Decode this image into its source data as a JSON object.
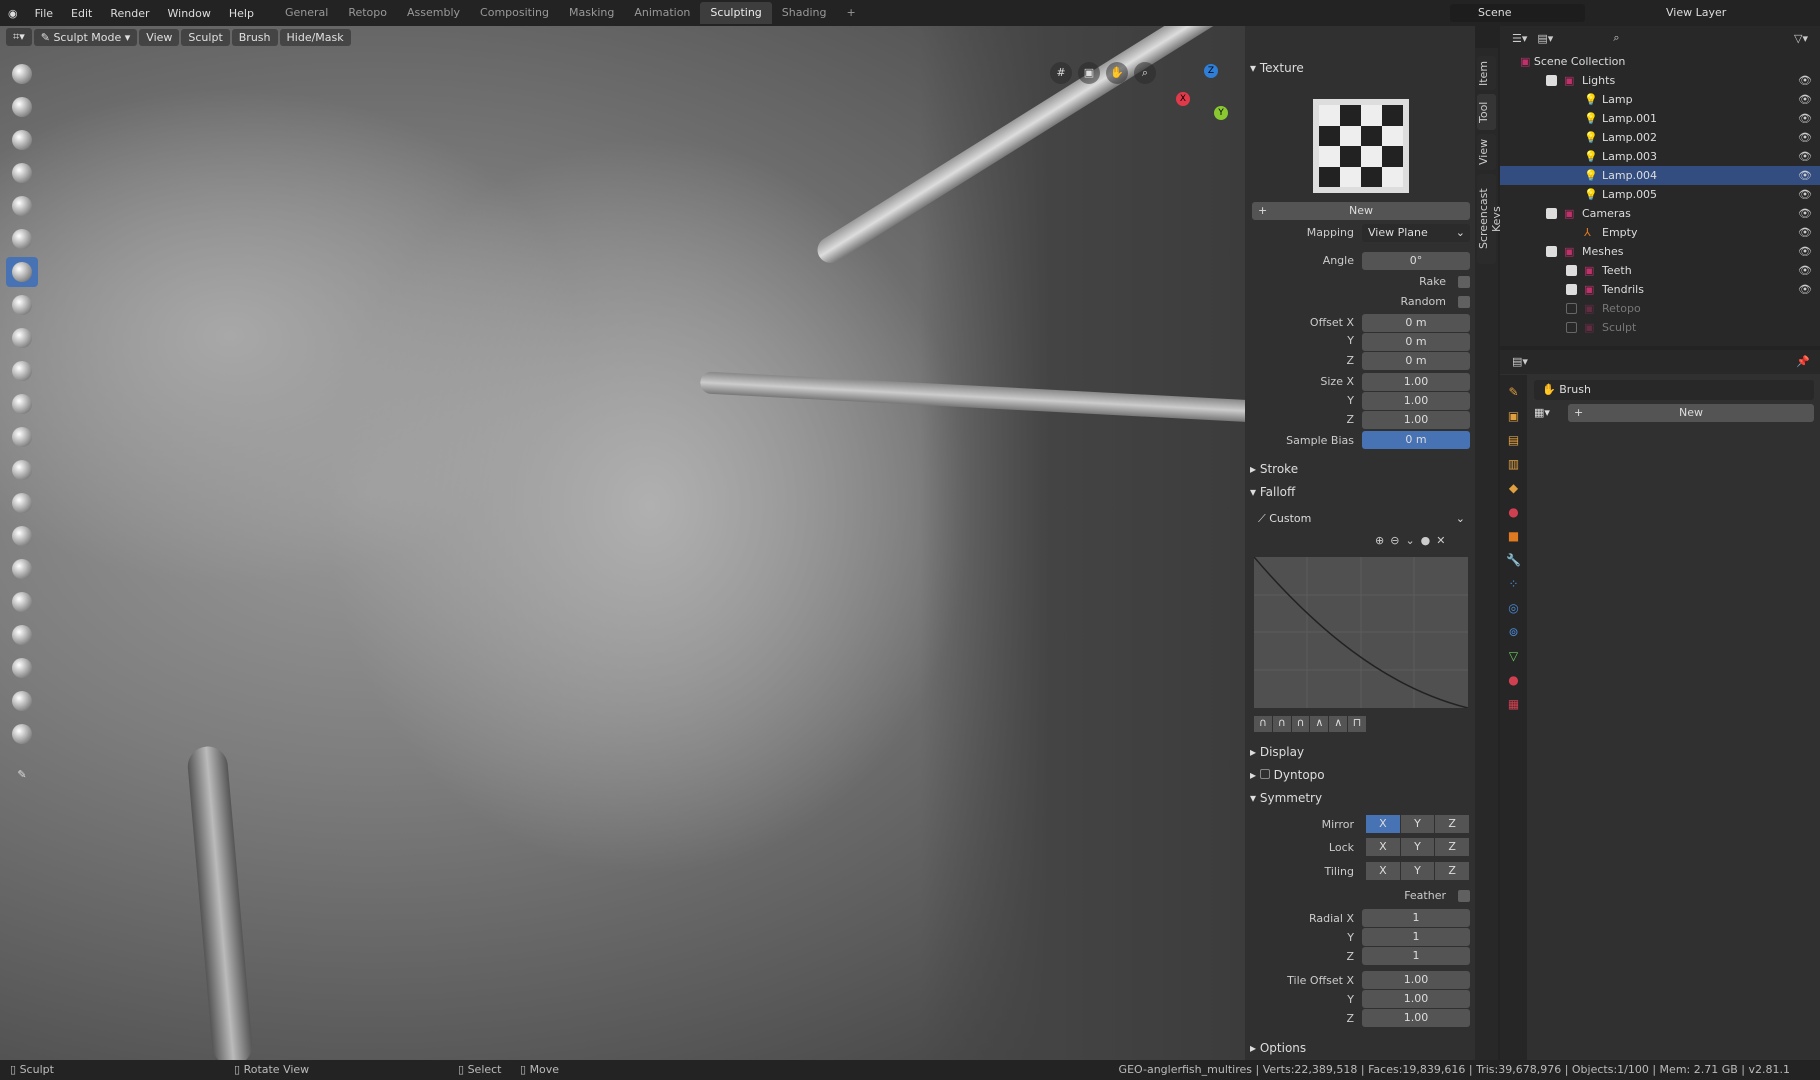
{
  "topbar": {
    "menus": [
      "File",
      "Edit",
      "Render",
      "Window",
      "Help"
    ],
    "workspaces": [
      "General",
      "Retopo",
      "Assembly",
      "Compositing",
      "Masking",
      "Animation",
      "Sculpting",
      "Shading"
    ],
    "active_workspace": "Sculpting",
    "scene": "Scene",
    "view_layer": "View Layer",
    "add_tab": "+"
  },
  "viewport_header": {
    "mode": "Sculpt Mode",
    "menus": [
      "View",
      "Sculpt",
      "Brush",
      "Hide/Mask"
    ]
  },
  "gizmo": {
    "x": "X",
    "y": "Y",
    "z": "Z"
  },
  "npanel": {
    "tabs": [
      "Item",
      "Tool",
      "View",
      "Screencast Keys"
    ],
    "active_tab": "Tool",
    "texture": {
      "title": "Texture",
      "new_label": "New",
      "mapping_label": "Mapping",
      "mapping": "View Plane",
      "angle_label": "Angle",
      "angle": "0°",
      "rake_label": "Rake",
      "random_label": "Random",
      "offset": {
        "label": "Offset X",
        "x": "0 m",
        "y": "0 m",
        "z": "0 m"
      },
      "size": {
        "label": "Size X",
        "x": "1.00",
        "y": "1.00",
        "z": "1.00"
      },
      "y_label": "Y",
      "z_label": "Z",
      "sample_bias_label": "Sample Bias",
      "sample_bias": "0 m"
    },
    "stroke": "Stroke",
    "falloff": {
      "title": "Falloff",
      "preset": "Custom"
    },
    "display": "Display",
    "dyntopo": "Dyntopo",
    "symmetry": {
      "title": "Symmetry",
      "mirror_label": "Mirror",
      "lock_label": "Lock",
      "tiling_label": "Tiling",
      "axes": [
        "X",
        "Y",
        "Z"
      ],
      "mirror_active": "X",
      "feather_label": "Feather",
      "radial": {
        "label": "Radial X",
        "x": "1",
        "y": "1",
        "z": "1"
      },
      "tile_offset": {
        "label": "Tile Offset X",
        "x": "1.00",
        "y": "1.00",
        "z": "1.00"
      }
    },
    "options": "Options"
  },
  "outliner": {
    "root": "Scene Collection",
    "items": [
      {
        "name": "Lights",
        "indent": 1,
        "type": "collection"
      },
      {
        "name": "Lamp",
        "indent": 2,
        "type": "light"
      },
      {
        "name": "Lamp.001",
        "indent": 2,
        "type": "light"
      },
      {
        "name": "Lamp.002",
        "indent": 2,
        "type": "light"
      },
      {
        "name": "Lamp.003",
        "indent": 2,
        "type": "light"
      },
      {
        "name": "Lamp.004",
        "indent": 2,
        "type": "light",
        "selected": true
      },
      {
        "name": "Lamp.005",
        "indent": 2,
        "type": "light"
      },
      {
        "name": "Cameras",
        "indent": 1,
        "type": "collection"
      },
      {
        "name": "Empty",
        "indent": 2,
        "type": "empty"
      },
      {
        "name": "Meshes",
        "indent": 1,
        "type": "collection"
      },
      {
        "name": "Teeth",
        "indent": 2,
        "type": "collection"
      },
      {
        "name": "Tendrils",
        "indent": 2,
        "type": "collection"
      },
      {
        "name": "Retopo",
        "indent": 2,
        "type": "collection",
        "disabled": true
      },
      {
        "name": "Sculpt",
        "indent": 2,
        "type": "collection",
        "disabled": true
      }
    ]
  },
  "properties": {
    "brush_label": "Brush",
    "new_label": "New"
  },
  "statusbar": {
    "sculpt": "Sculpt",
    "rotate": "Rotate View",
    "select": "Select",
    "move": "Move",
    "stats": "GEO-anglerfish_multires | Verts:22,389,518 | Faces:19,839,616 | Tris:39,678,976 | Objects:1/100 | Mem: 2.71 GB | v2.81.1"
  },
  "colors": {
    "accent": "#4772b3",
    "selection": "#334d80",
    "collection": "#c0306a",
    "light": "#e07a20"
  }
}
